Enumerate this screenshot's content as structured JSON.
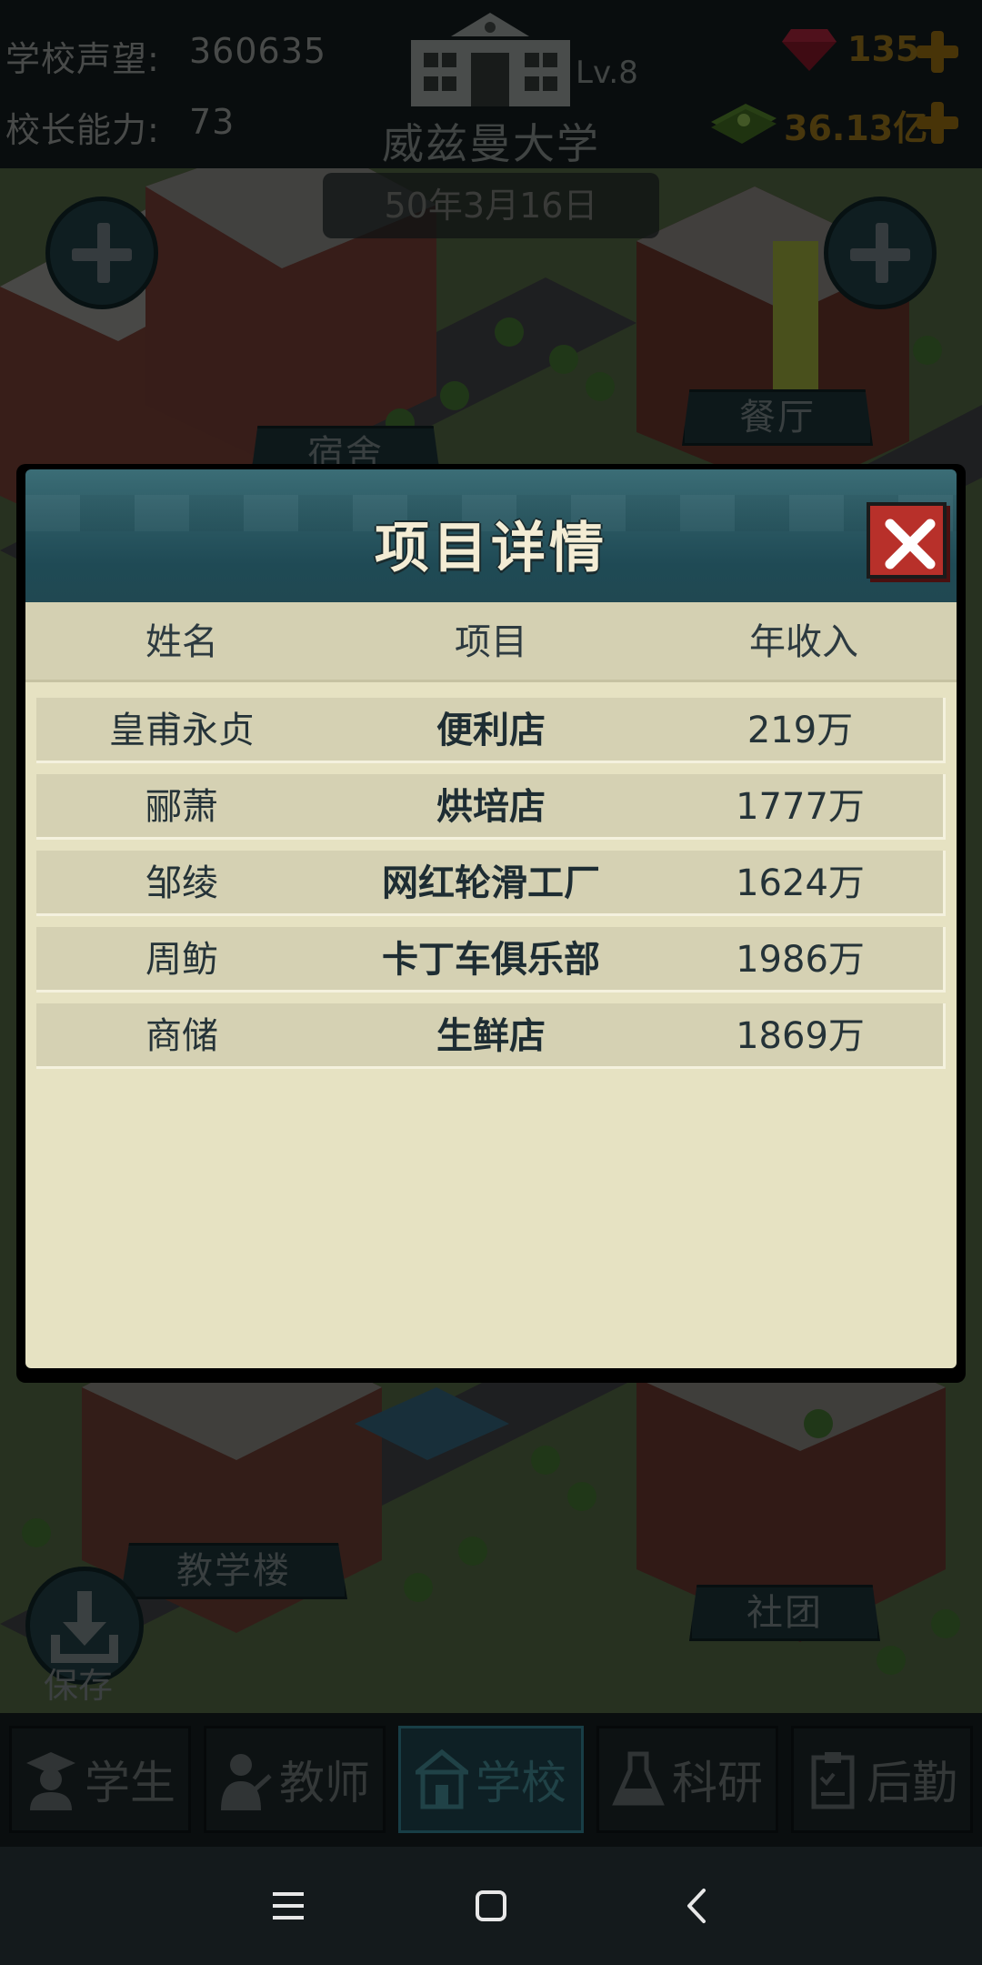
{
  "top_bar": {
    "reputation_label": "学校声望:",
    "reputation_value": "360635",
    "ability_label": "校长能力:",
    "ability_value": "73",
    "school_level": "Lv.8",
    "school_name": "威兹曼大学",
    "gems": "135",
    "money": "36.13亿",
    "date": "50年3月16日"
  },
  "map": {
    "labels": {
      "dorm": "宿舍",
      "canteen": "餐厅",
      "teaching": "教学楼",
      "club": "社团"
    },
    "save_label": "保存"
  },
  "modal": {
    "title": "项目详情",
    "columns": [
      "姓名",
      "项目",
      "年收入"
    ],
    "rows": [
      {
        "name": "皇甫永贞",
        "project": "便利店",
        "income": "219万"
      },
      {
        "name": "郦萧",
        "project": "烘培店",
        "income": "1777万"
      },
      {
        "name": "邹绫",
        "project": "网红轮滑工厂",
        "income": "1624万"
      },
      {
        "name": "周鲂",
        "project": "卡丁车俱乐部",
        "income": "1986万"
      },
      {
        "name": "商储",
        "project": "生鲜店",
        "income": "1869万"
      }
    ]
  },
  "bottom_nav": {
    "tabs": [
      {
        "label": "学生",
        "icon": "student-icon"
      },
      {
        "label": "教师",
        "icon": "teacher-icon"
      },
      {
        "label": "学校",
        "icon": "school-icon",
        "active": true
      },
      {
        "label": "科研",
        "icon": "flask-icon"
      },
      {
        "label": "后勤",
        "icon": "clipboard-icon"
      }
    ]
  },
  "colors": {
    "accent_teal": "#2f7886",
    "close_red": "#b8302a",
    "gold": "#8a6410",
    "panel_bg": "#e6e2c2"
  }
}
